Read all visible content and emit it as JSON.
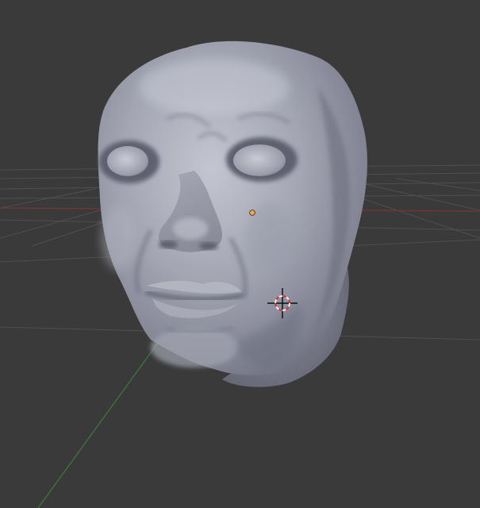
{
  "viewport": {
    "background_color": "#3a3a3a",
    "grid_color": "#4e4e4e",
    "x_axis_color": "#7a3434",
    "y_axis_color": "#3f7a3f",
    "origin_color": "#f7a14b",
    "cursor_colors": [
      "#d83030",
      "#f0f0f0",
      "#111111"
    ]
  },
  "object": {
    "type": "sculpted-head-mesh",
    "base_color": "#9ea0ae",
    "shadow_color": "#5e606c",
    "highlight_color": "#d4d6e0"
  },
  "icons": {
    "origin": "object-origin-dot",
    "cursor": "3d-cursor-icon"
  }
}
